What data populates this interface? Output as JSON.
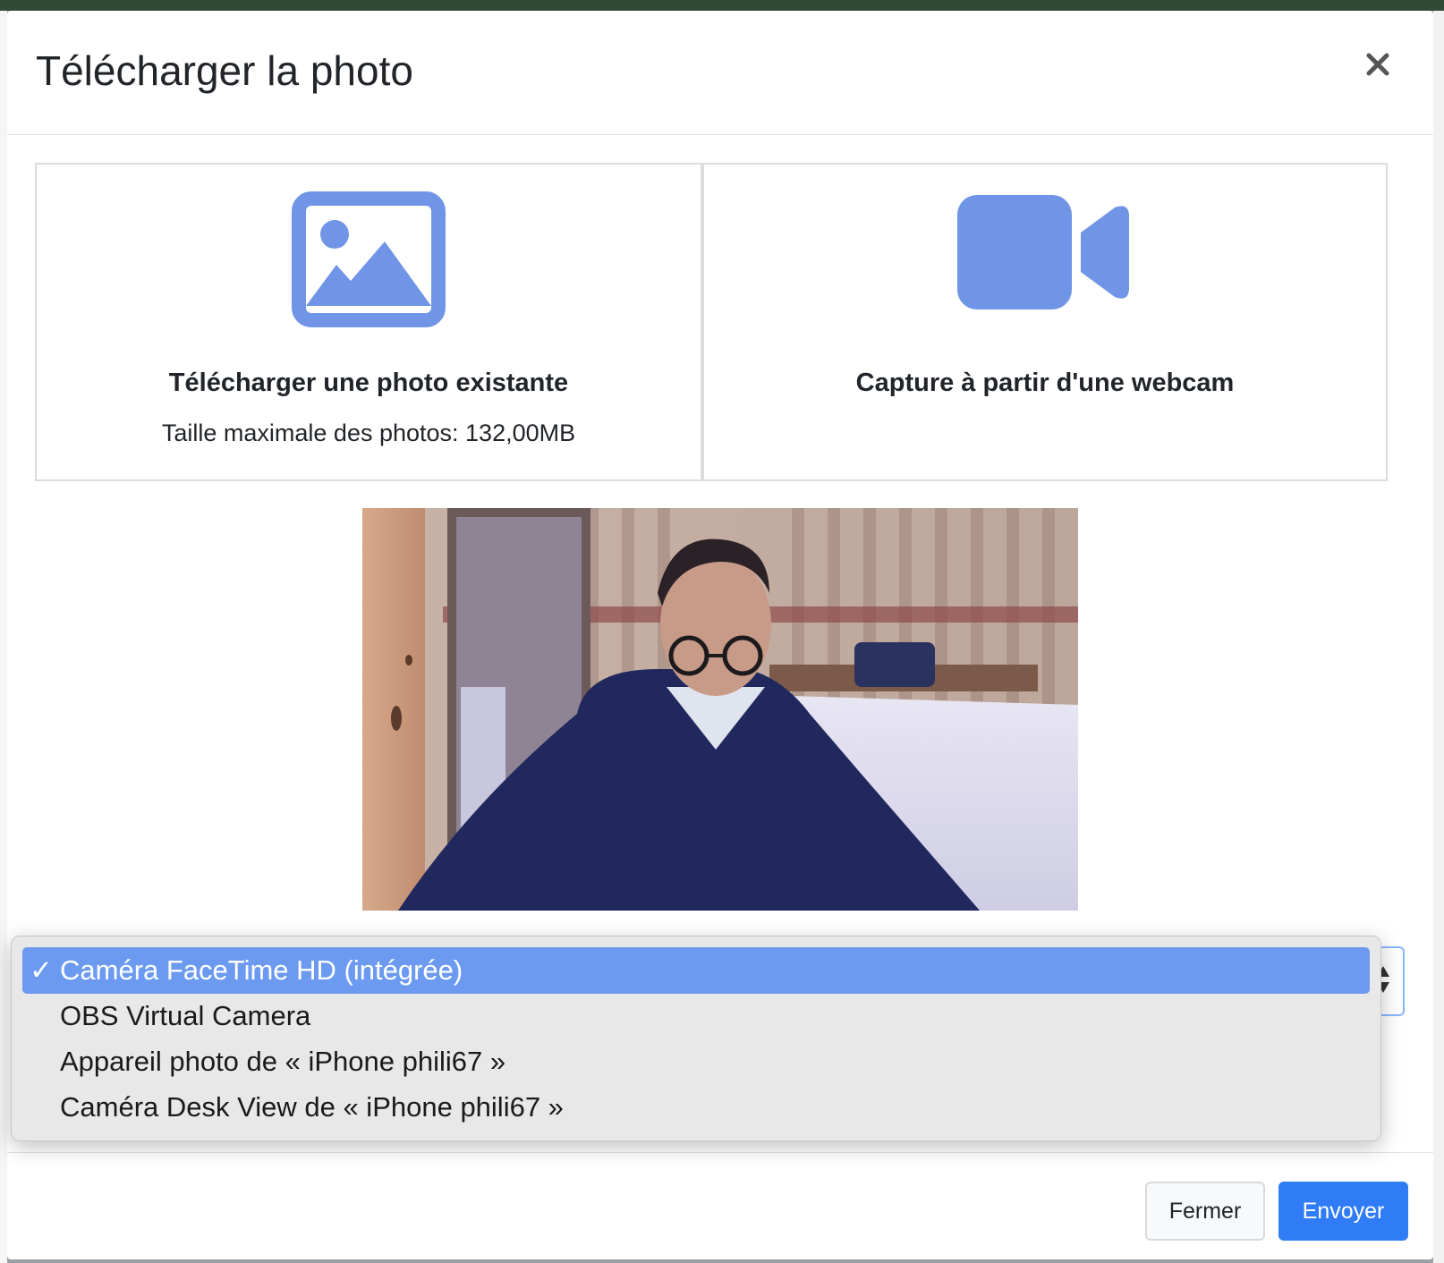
{
  "modal": {
    "title": "Télécharger la photo",
    "close_icon": "close-icon"
  },
  "options": {
    "upload": {
      "icon": "image-icon",
      "title": "Télécharger une photo existante",
      "subtitle": "Taille maximale des photos: 132,00MB"
    },
    "webcam": {
      "icon": "video-camera-icon",
      "title": "Capture à partir d'une webcam"
    }
  },
  "camera_select": {
    "selected": "Caméra FaceTime HD (intégrée)",
    "options": [
      "Caméra FaceTime HD (intégrée)",
      "OBS Virtual Camera",
      "Appareil photo de « iPhone phili67 »",
      "Caméra Desk View de « iPhone phili67 »"
    ],
    "check_glyph": "✓"
  },
  "footer": {
    "close_label": "Fermer",
    "send_label": "Envoyer"
  },
  "colors": {
    "icon_blue": "#7095e6",
    "primary": "#2f7cf6",
    "selected_option": "#6b9af0"
  }
}
